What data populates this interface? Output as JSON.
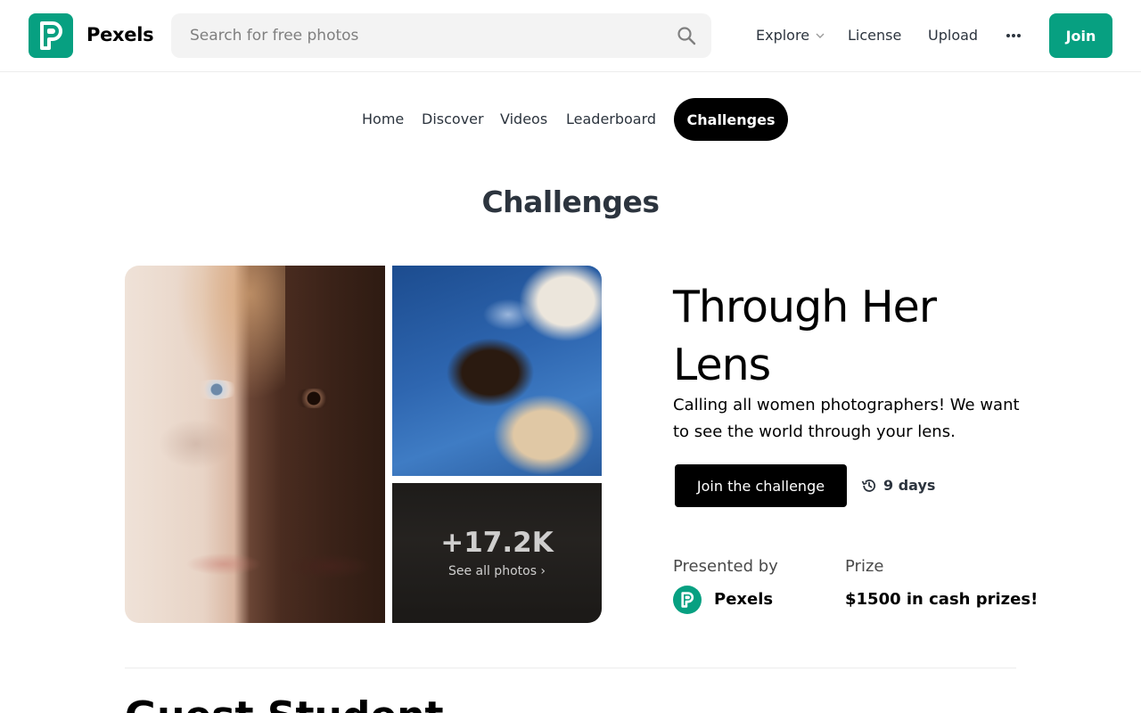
{
  "header": {
    "brand": "Pexels",
    "search_placeholder": "Search for free photos",
    "nav": {
      "explore": "Explore",
      "license": "License",
      "upload": "Upload"
    },
    "join_label": "Join"
  },
  "subnav": {
    "items": [
      "Home",
      "Discover",
      "Videos",
      "Leaderboard"
    ],
    "active": "Challenges"
  },
  "page_title": "Challenges",
  "challenge": {
    "title": "Through Her Lens",
    "description": "Calling all women photographers! We want to see the world through your lens.",
    "join_label": "Join the challenge",
    "time_left": "9 days",
    "photo_count": "+17.2K",
    "see_all": "See all photos ›",
    "presented_by_label": "Presented by",
    "presenter": "Pexels",
    "prize_label": "Prize",
    "prize": "$1500 in cash prizes!"
  },
  "next_section_title": "Guest Student",
  "colors": {
    "brand": "#07a081",
    "text": "#2c343e",
    "black": "#000000"
  },
  "icons": {
    "logo": "pexels-logo-icon",
    "search": "search-icon",
    "chevron": "chevron-down-icon",
    "more": "more-horizontal-icon",
    "history": "history-clock-icon"
  }
}
